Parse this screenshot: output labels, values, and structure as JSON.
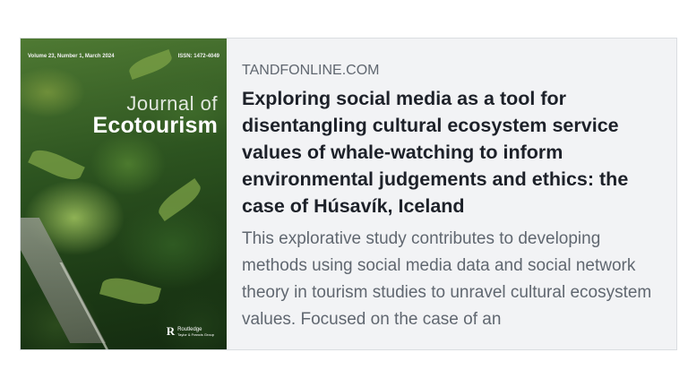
{
  "card": {
    "domain": "TANDFONLINE.COM",
    "title": "Exploring social media as a tool for disentangling cultural ecosystem service values of whale-watching to inform environmental judgements and ethics: the case of Húsavík, Iceland",
    "description": "This explorative study contributes to developing methods using social media data and social network theory in tourism studies to unravel cultural ecosystem values. Focused on the case of an"
  },
  "cover": {
    "issue": "Volume 23, Number 1, March 2024",
    "issn": "ISSN: 1472-4049",
    "journal_prefix": "Journal of",
    "journal_name": "Ecotourism",
    "publisher": "Routledge",
    "publisher_sub": "Taylor & Francis Group",
    "logo_icon": "routledge-r-icon"
  },
  "colors": {
    "card_bg": "#f2f3f5",
    "title": "#1d2129",
    "muted": "#606770"
  }
}
